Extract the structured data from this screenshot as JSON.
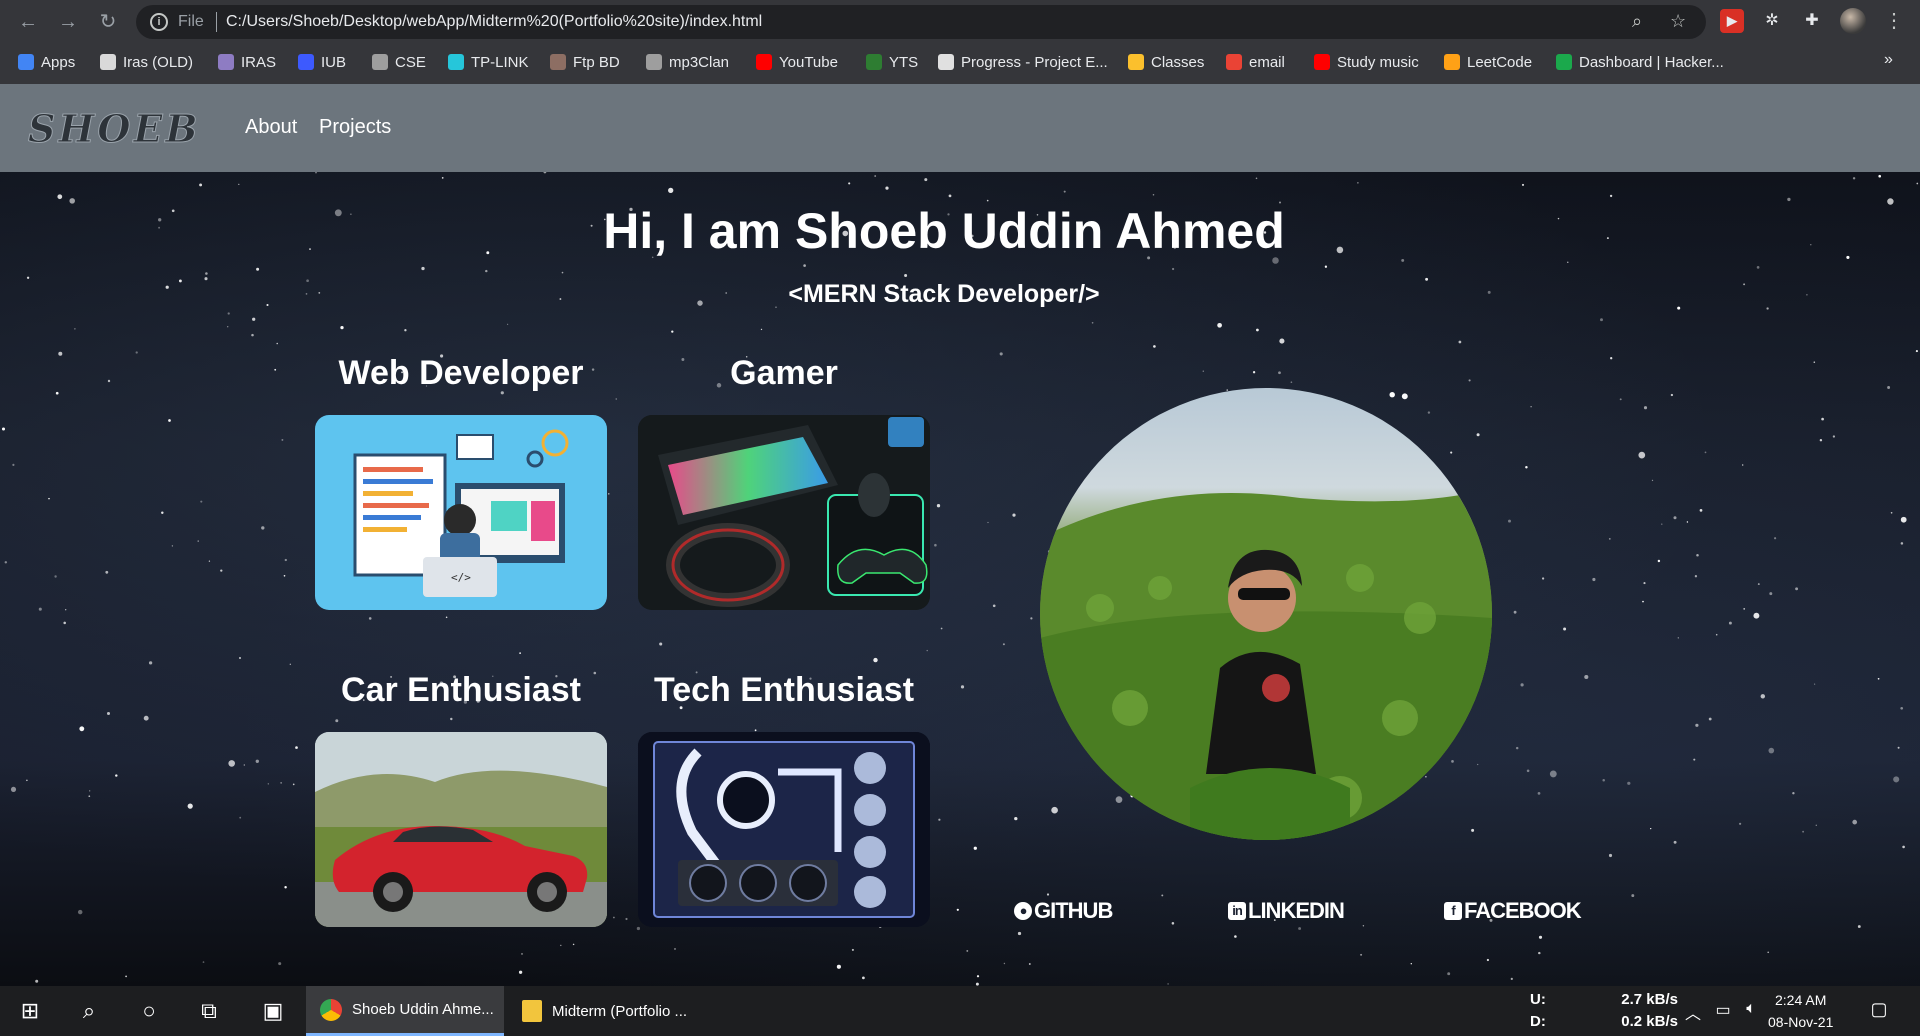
{
  "browser": {
    "url_scheme_label": "File",
    "url": "C:/Users/Shoeb/Desktop/webApp/Midterm%20(Portfolio%20site)/index.html",
    "bookmarks": [
      {
        "label": "Apps",
        "color": "#4285f4"
      },
      {
        "label": "Iras (OLD)",
        "color": "#d9d9d9"
      },
      {
        "label": "IRAS",
        "color": "#8e7cc3"
      },
      {
        "label": "IUB",
        "color": "#3d5afe"
      },
      {
        "label": "CSE",
        "color": "#9e9e9e"
      },
      {
        "label": "TP-LINK",
        "color": "#26c6da"
      },
      {
        "label": "Ftp BD",
        "color": "#8d6e63"
      },
      {
        "label": "mp3Clan",
        "color": "#9e9e9e"
      },
      {
        "label": "YouTube",
        "color": "#ff0000"
      },
      {
        "label": "YTS",
        "color": "#2e7d32"
      },
      {
        "label": "Progress - Project E...",
        "color": "#e0e0e0"
      },
      {
        "label": "Classes",
        "color": "#fbc02d"
      },
      {
        "label": "email",
        "color": "#ea4335"
      },
      {
        "label": "Study music",
        "color": "#ff0000"
      },
      {
        "label": "LeetCode",
        "color": "#ffa116"
      },
      {
        "label": "Dashboard | Hacker...",
        "color": "#1ba94c"
      }
    ],
    "more_bookmarks": "»"
  },
  "site": {
    "logo": "SHOEB",
    "nav": {
      "about": "About",
      "projects": "Projects"
    },
    "hero_title": "Hi, I am Shoeb Uddin Ahmed",
    "hero_subtitle": "<MERN Stack Developer/>",
    "cards": [
      {
        "title": "Web Developer",
        "image": "web-developer-illustration"
      },
      {
        "title": "Gamer",
        "image": "gaming-setup-photo"
      },
      {
        "title": "Car Enthusiast",
        "image": "red-sports-car-photo"
      },
      {
        "title": "Tech Enthusiast",
        "image": "pc-build-photo"
      }
    ],
    "social": {
      "github": "GITHUB",
      "linkedin": "LINKEDIN",
      "facebook": "FACEBOOK"
    }
  },
  "taskbar": {
    "apps": [
      {
        "label": "Shoeb Uddin Ahme...",
        "icon": "chrome-icon"
      },
      {
        "label": "Midterm (Portfolio ...",
        "icon": "folder-icon"
      }
    ],
    "net_up_label": "U:",
    "net_down_label": "D:",
    "net_up": "2.7 kB/s",
    "net_down": "0.2 kB/s",
    "time": "2:24 AM",
    "date": "08-Nov-21"
  }
}
